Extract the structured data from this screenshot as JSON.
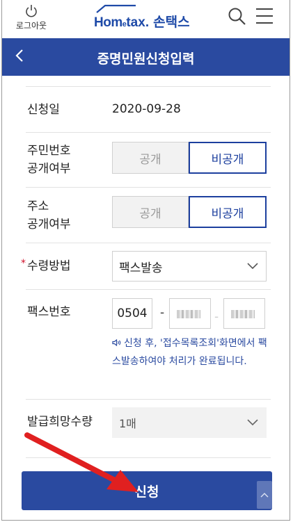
{
  "header": {
    "logout_label": "로그아웃",
    "brand_home": "Hom",
    "brand_e": "e",
    "brand_tax": "tax.",
    "brand_name": "손택스"
  },
  "titlebar": {
    "back_icon": "chevron-left-icon",
    "title": "증명민원신청입력"
  },
  "form": {
    "apply_date": {
      "label": "신청일",
      "value": "2020-09-28"
    },
    "resident_no_disclosure": {
      "label_line1": "주민번호",
      "label_line2": "공개여부",
      "options": [
        "공개",
        "비공개"
      ],
      "selected": "비공개"
    },
    "address_disclosure": {
      "label_line1": "주소",
      "label_line2": "공개여부",
      "options": [
        "공개",
        "비공개"
      ],
      "selected": "비공개"
    },
    "receive_method": {
      "required_mark": "*",
      "label": "수령방법",
      "value": "팩스발송"
    },
    "fax_number": {
      "label": "팩스번호",
      "part1": "0504",
      "separator": "-",
      "notice": "신청 후, '접수목록조회'화면에서 팩스발송하여야 처리가 완료됩니다."
    },
    "quantity": {
      "label": "발급희망수량",
      "value": "1매"
    }
  },
  "submit_label": "신청",
  "colors": {
    "primary": "#2a4aa0",
    "selected_border": "#1c3f9e",
    "required": "#d0102a",
    "annotation_arrow": "#e02020"
  }
}
